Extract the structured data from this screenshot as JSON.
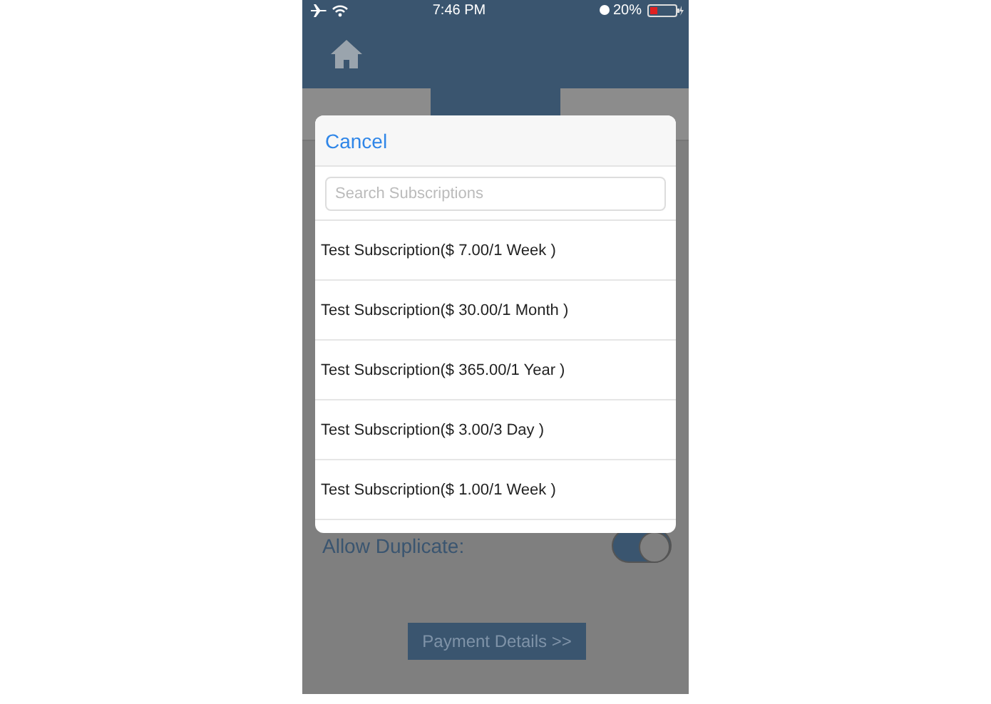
{
  "status_bar": {
    "time": "7:46 PM",
    "battery": "20%"
  },
  "tabs": [
    {
      "selected": false
    },
    {
      "selected": true
    },
    {
      "selected": false
    }
  ],
  "settings": [
    {
      "label": "Allow Duplicate:",
      "on": true
    }
  ],
  "buttons": [
    "Payment Details >>"
  ],
  "picker": {
    "cancel": "Cancel",
    "search": {
      "placeholder": "Search Subscriptions"
    },
    "items": [
      "Test Subscription($ 7.00/1 Week )",
      "Test Subscription($ 30.00/1 Month )",
      "Test Subscription($ 365.00/1 Year )",
      "Test Subscription($ 3.00/3 Day )",
      "Test Subscription($ 1.00/1 Week )"
    ]
  }
}
